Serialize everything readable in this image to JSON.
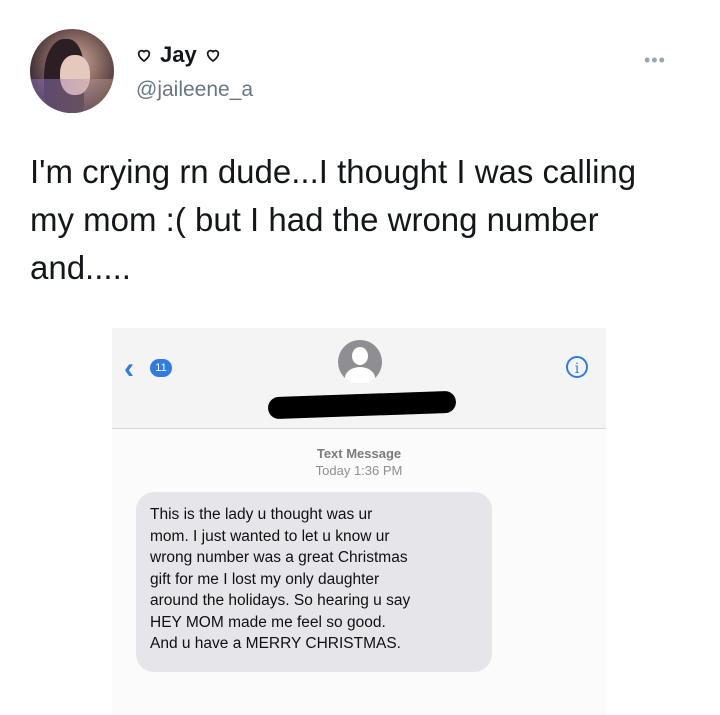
{
  "tweet": {
    "display_name": "Jay",
    "handle": "@jaileene_a",
    "more_label": "•••",
    "text": "I'm crying rn dude...I thought I was calling my mom :( but I had the wrong number and....."
  },
  "embedded_screenshot": {
    "back_badge": "11",
    "info_label": "i",
    "message_type": "Text Message",
    "timestamp": "Today 1:36 PM",
    "message": "This is the lady u thought was ur\nmom. I just wanted to let u know ur\nwrong number was a great Christmas\ngift for me I lost my only daughter\naround the holidays. So hearing u say\nHEY MOM made me feel so good.\nAnd u have a MERRY CHRISTMAS."
  },
  "colors": {
    "ios_blue": "#2f7de1",
    "bubble_gray": "#e5e5ea",
    "handle_gray": "#657786"
  },
  "icons": [
    "heart-outline-icon",
    "more-icon",
    "back-chevron-icon",
    "contact-avatar-icon",
    "info-icon"
  ]
}
